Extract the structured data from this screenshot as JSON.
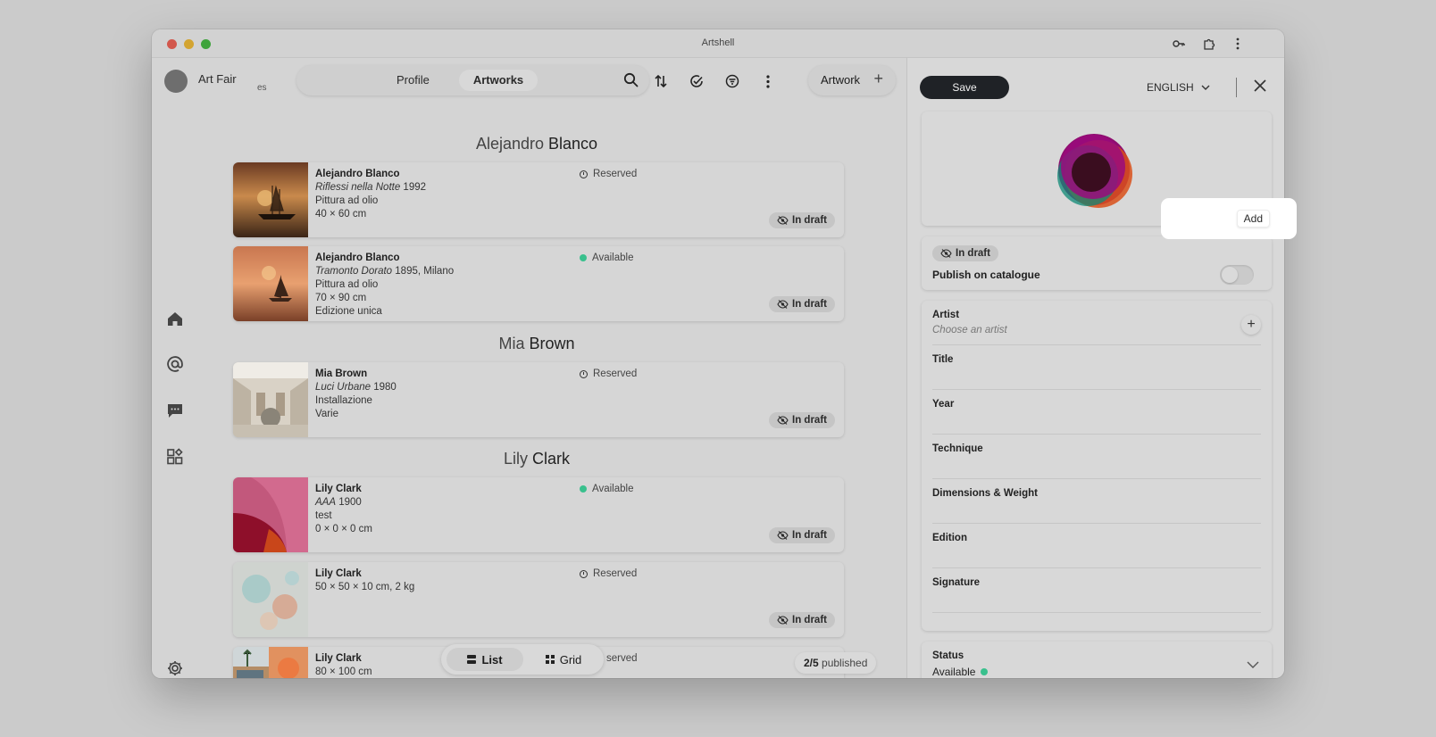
{
  "window": {
    "title": "Artshell"
  },
  "header": {
    "org_name": "Art Fair",
    "org_sub": "es",
    "tabs": [
      {
        "label": "Profile"
      },
      {
        "label": "Artworks"
      }
    ],
    "add_artwork_label": "Artwork"
  },
  "groups": [
    {
      "first": "Alejandro",
      "last": "Blanco"
    },
    {
      "first": "Mia",
      "last": "Brown"
    },
    {
      "first": "Lily",
      "last": "Clark"
    }
  ],
  "cards": [
    {
      "artist": "Alejandro Blanco",
      "title": "Riflessi nella Notte",
      "title_suffix": " 1992",
      "line2": "Pittura ad olio",
      "line3": "40 × 60 cm",
      "line4": "",
      "status": "Reserved",
      "badge": "In draft"
    },
    {
      "artist": "Alejandro Blanco",
      "title": "Tramonto Dorato",
      "title_suffix": " 1895, Milano",
      "line2": "Pittura ad olio",
      "line3": "70 × 90 cm",
      "line4": "Edizione unica",
      "status": "Available",
      "badge": "In draft"
    },
    {
      "artist": "Mia Brown",
      "title": "Luci Urbane",
      "title_suffix": " 1980",
      "line2": "Installazione",
      "line3": "Varie",
      "line4": "",
      "status": "Reserved",
      "badge": "In draft"
    },
    {
      "artist": "Lily Clark",
      "title": "AAA",
      "title_suffix": " 1900",
      "line2": "test",
      "line3": "0 × 0 × 0 cm",
      "line4": "",
      "status": "Available",
      "badge": "In draft"
    },
    {
      "artist": "Lily Clark",
      "title": "",
      "title_suffix": "",
      "line1": "50 × 50 × 10 cm, 2 kg",
      "status": "Reserved",
      "badge": "In draft"
    },
    {
      "artist": "Lily Clark",
      "line1": "80 × 100 cm",
      "status_partial": "served"
    }
  ],
  "bottom": {
    "list_label": "List",
    "grid_label": "Grid",
    "published_count": "2/5",
    "published_label": " published"
  },
  "editor": {
    "save_label": "Save",
    "language": "ENGLISH",
    "add_label": "Add",
    "draft_badge": "In draft",
    "publish_label": "Publish on catalogue",
    "publish_on": false,
    "fields": [
      {
        "label": "Artist",
        "placeholder": "Choose an artist"
      },
      {
        "label": "Title"
      },
      {
        "label": "Year"
      },
      {
        "label": "Technique"
      },
      {
        "label": "Dimensions & Weight"
      },
      {
        "label": "Edition"
      },
      {
        "label": "Signature"
      }
    ],
    "status_label": "Status",
    "status_value": "Available"
  },
  "colors": {
    "available": "#39c08d",
    "save_bg": "#1f2226"
  }
}
